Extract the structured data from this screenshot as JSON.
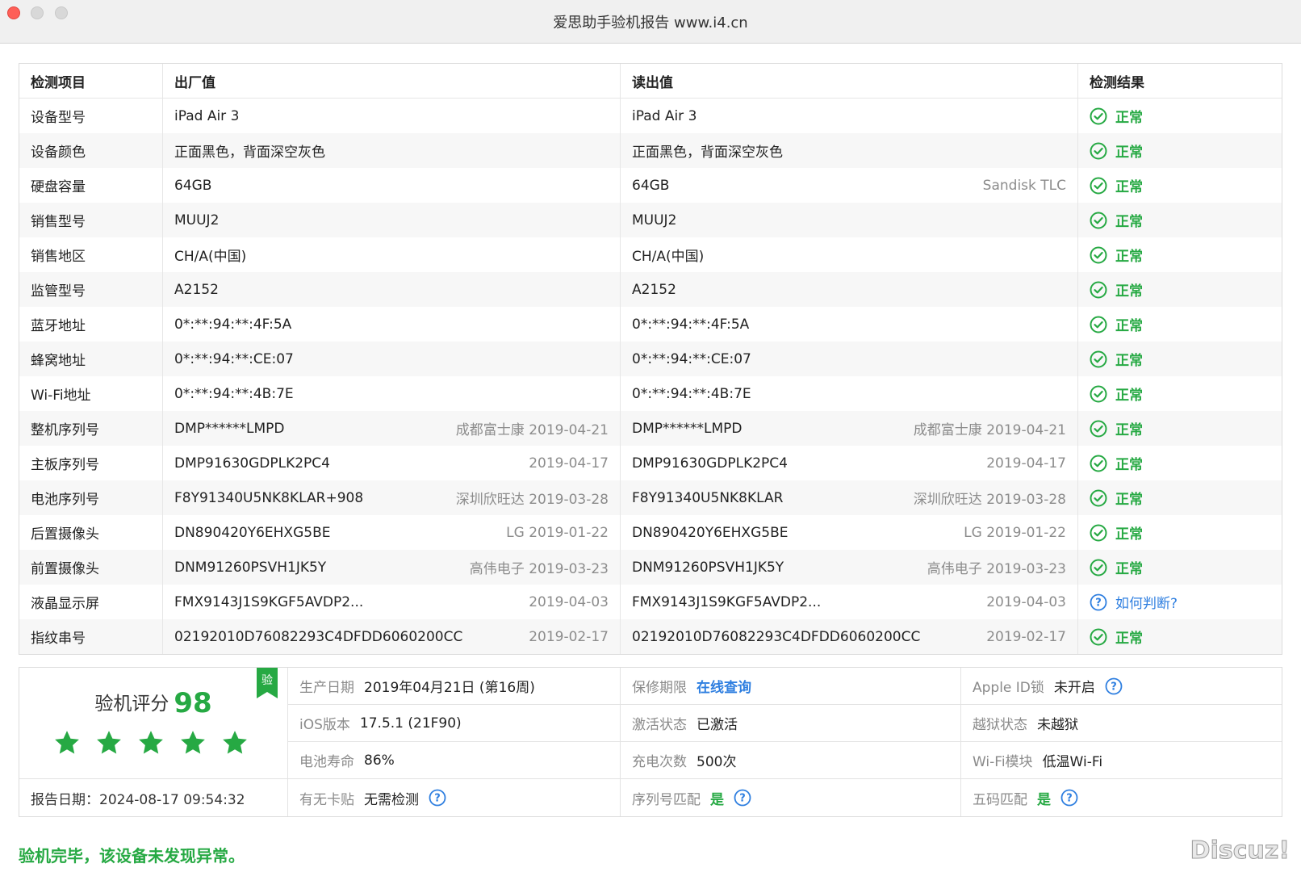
{
  "window": {
    "title": "爱思助手验机报告 www.i4.cn"
  },
  "table": {
    "headers": [
      "检测项目",
      "出厂值",
      "读出值",
      "检测结果"
    ],
    "rows": [
      {
        "item": "设备型号",
        "factory": "iPad Air 3",
        "factory_sub": "",
        "read": "iPad Air 3",
        "read_sub": "",
        "result": "正常",
        "status": "ok"
      },
      {
        "item": "设备颜色",
        "factory": "正面黑色，背面深空灰色",
        "factory_sub": "",
        "read": "正面黑色，背面深空灰色",
        "read_sub": "",
        "result": "正常",
        "status": "ok"
      },
      {
        "item": "硬盘容量",
        "factory": "64GB",
        "factory_sub": "",
        "read": "64GB",
        "read_sub": "Sandisk TLC",
        "result": "正常",
        "status": "ok"
      },
      {
        "item": "销售型号",
        "factory": "MUUJ2",
        "factory_sub": "",
        "read": "MUUJ2",
        "read_sub": "",
        "result": "正常",
        "status": "ok"
      },
      {
        "item": "销售地区",
        "factory": "CH/A(中国)",
        "factory_sub": "",
        "read": "CH/A(中国)",
        "read_sub": "",
        "result": "正常",
        "status": "ok"
      },
      {
        "item": "监管型号",
        "factory": "A2152",
        "factory_sub": "",
        "read": "A2152",
        "read_sub": "",
        "result": "正常",
        "status": "ok"
      },
      {
        "item": "蓝牙地址",
        "factory": "0*:**:94:**:4F:5A",
        "factory_sub": "",
        "read": "0*:**:94:**:4F:5A",
        "read_sub": "",
        "result": "正常",
        "status": "ok"
      },
      {
        "item": "蜂窝地址",
        "factory": "0*:**:94:**:CE:07",
        "factory_sub": "",
        "read": "0*:**:94:**:CE:07",
        "read_sub": "",
        "result": "正常",
        "status": "ok"
      },
      {
        "item": "Wi-Fi地址",
        "factory": "0*:**:94:**:4B:7E",
        "factory_sub": "",
        "read": "0*:**:94:**:4B:7E",
        "read_sub": "",
        "result": "正常",
        "status": "ok"
      },
      {
        "item": "整机序列号",
        "factory": "DMP******LMPD",
        "factory_sub": "成都富士康 2019-04-21",
        "read": "DMP******LMPD",
        "read_sub": "成都富士康 2019-04-21",
        "result": "正常",
        "status": "ok"
      },
      {
        "item": "主板序列号",
        "factory": "DMP91630GDPLK2PC4",
        "factory_sub": "2019-04-17",
        "read": "DMP91630GDPLK2PC4",
        "read_sub": "2019-04-17",
        "result": "正常",
        "status": "ok"
      },
      {
        "item": "电池序列号",
        "factory": "F8Y91340U5NK8KLAR+908",
        "factory_sub": "深圳欣旺达 2019-03-28",
        "read": "F8Y91340U5NK8KLAR",
        "read_sub": "深圳欣旺达 2019-03-28",
        "result": "正常",
        "status": "ok"
      },
      {
        "item": "后置摄像头",
        "factory": "DN890420Y6EHXG5BE",
        "factory_sub": "LG 2019-01-22",
        "read": "DN890420Y6EHXG5BE",
        "read_sub": "LG 2019-01-22",
        "result": "正常",
        "status": "ok"
      },
      {
        "item": "前置摄像头",
        "factory": "DNM91260PSVH1JK5Y",
        "factory_sub": "高伟电子 2019-03-23",
        "read": "DNM91260PSVH1JK5Y",
        "read_sub": "高伟电子 2019-03-23",
        "result": "正常",
        "status": "ok"
      },
      {
        "item": "液晶显示屏",
        "factory": "FMX9143J1S9KGF5AVDP2...",
        "factory_sub": "2019-04-03",
        "read": "FMX9143J1S9KGF5AVDP2...",
        "read_sub": "2019-04-03",
        "result": "如何判断?",
        "status": "question"
      },
      {
        "item": "指纹串号",
        "factory": "02192010D76082293C4DFDD6060200CC",
        "factory_sub": "2019-02-17",
        "read": "02192010D76082293C4DFDD6060200CC",
        "read_sub": "2019-02-17",
        "result": "正常",
        "status": "ok"
      }
    ]
  },
  "summary": {
    "score_label": "验机评分",
    "score": "98",
    "stars": 5,
    "badge": "验",
    "report_date": "报告日期：2024-08-17 09:54:32",
    "rows": [
      [
        {
          "label": "生产日期",
          "value": "2019年04月21日 (第16周)",
          "style": "normal",
          "help": false
        },
        {
          "label": "保修期限",
          "value": "在线查询",
          "style": "link",
          "help": false
        },
        {
          "label": "Apple ID锁",
          "value": "未开启",
          "style": "normal",
          "help": true
        }
      ],
      [
        {
          "label": "iOS版本",
          "value": "17.5.1 (21F90)",
          "style": "normal",
          "help": false
        },
        {
          "label": "激活状态",
          "value": "已激活",
          "style": "normal",
          "help": false
        },
        {
          "label": "越狱状态",
          "value": "未越狱",
          "style": "normal",
          "help": false
        }
      ],
      [
        {
          "label": "电池寿命",
          "value": "86%",
          "style": "normal",
          "help": false
        },
        {
          "label": "充电次数",
          "value": "500次",
          "style": "normal",
          "help": false
        },
        {
          "label": "Wi-Fi模块",
          "value": "低温Wi-Fi",
          "style": "normal",
          "help": false
        }
      ],
      [
        {
          "label": "有无卡贴",
          "value": "无需检测",
          "style": "normal",
          "help": true
        },
        {
          "label": "序列号匹配",
          "value": "是",
          "style": "green",
          "help": true
        },
        {
          "label": "五码匹配",
          "value": "是",
          "style": "green",
          "help": true
        }
      ]
    ]
  },
  "footer": {
    "message": "验机完毕，该设备未发现异常。"
  },
  "watermark": "Discuz!",
  "colors": {
    "ok": "#26a943",
    "link": "#2f7fe0",
    "close": "#fe5f57"
  }
}
